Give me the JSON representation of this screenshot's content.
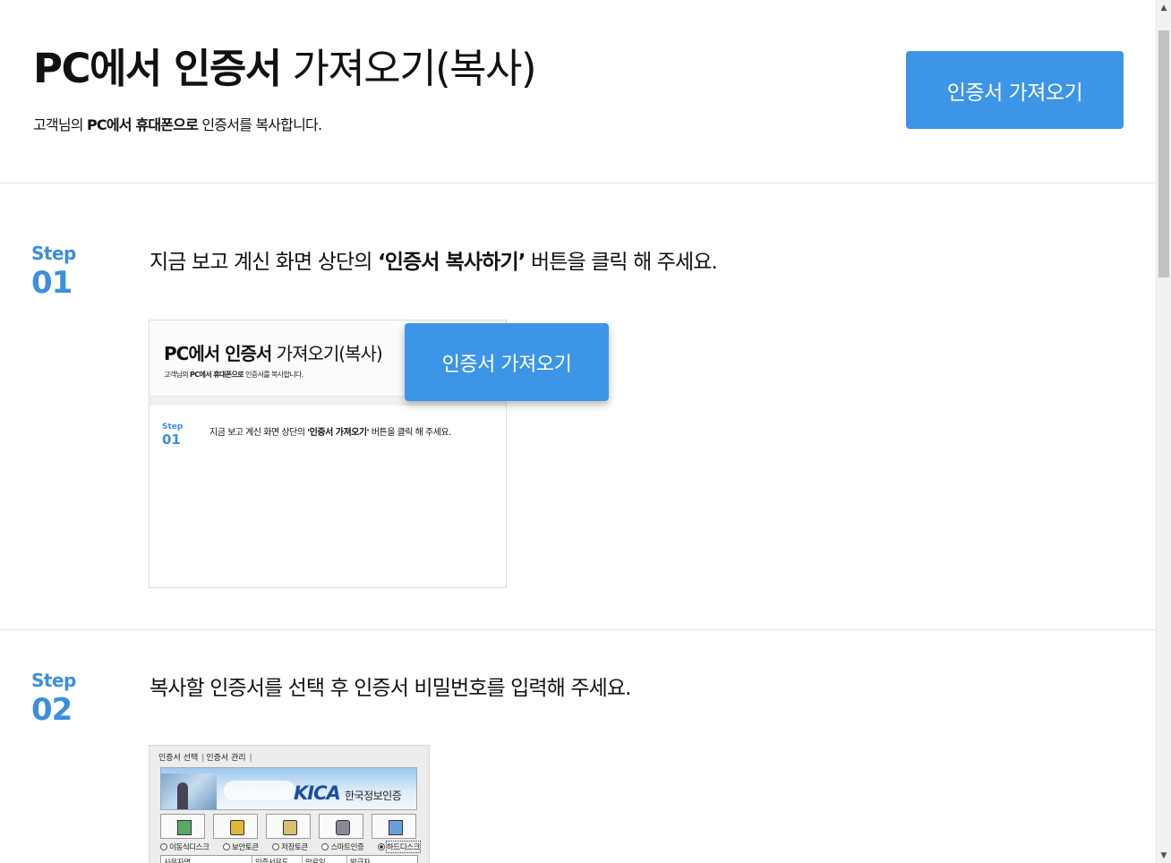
{
  "header": {
    "title_bold": "PC에서 인증서",
    "title_rest": "가져오기(복사)",
    "subtitle_pre": "고객님의",
    "subtitle_bold": "PC에서 휴대폰으로",
    "subtitle_post": "인증서를 복사합니다.",
    "import_button": "인증서 가져오기"
  },
  "steps": [
    {
      "label": "Step",
      "number": "01",
      "text_pre": "지금 보고 계신 화면 상단의",
      "text_bold": "‘인증서 복사하기’",
      "text_post": "버튼을 클릭 해 주세요."
    },
    {
      "label": "Step",
      "number": "02",
      "text": "복사할 인증서를 선택 후 인증서 비밀번호를 입력해 주세요."
    }
  ],
  "preview1": {
    "title_bold": "PC에서 인증서",
    "title_rest": "가져오기(복사)",
    "sub_pre": "고객님의",
    "sub_bold": "PC에서 휴대폰으로",
    "sub_post": "인증서를 복사합니다.",
    "step_label": "Step",
    "step_number": "01",
    "text_pre": "지금 보고 계신 화면 상단의",
    "text_bold": "'인증서 가져오기'",
    "text_post": "버튼을 클릭 해 주세요.",
    "button": "인증서 가져오기"
  },
  "preview2": {
    "tabs": [
      "인증서 선택",
      "인증서 관리"
    ],
    "logo_text": "KICA",
    "logo_kr": "한국정보인증",
    "media_options": [
      {
        "label": "이동식디스크",
        "icon": "usb-drive-icon",
        "selected": false
      },
      {
        "label": "보안토큰",
        "icon": "security-token-icon",
        "selected": false
      },
      {
        "label": "저장토큰",
        "icon": "storage-token-icon",
        "selected": false
      },
      {
        "label": "스마트인증",
        "icon": "smartphone-icon",
        "selected": false
      },
      {
        "label": "하드디스크",
        "icon": "hard-disk-icon",
        "selected": true
      }
    ],
    "columns": [
      "사용자명",
      "인증서용도",
      "만료일",
      "발급자"
    ]
  },
  "colors": {
    "accent": "#3c95e6",
    "step_blue": "#3c8fdf",
    "divider": "#e4e4e4"
  }
}
